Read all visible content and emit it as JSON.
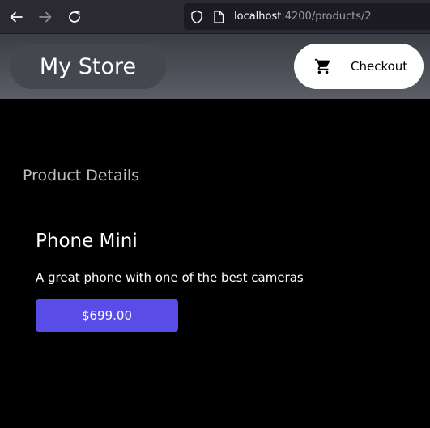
{
  "browser": {
    "url_host": "localhost",
    "url_path": ":4200/products/2"
  },
  "toolbar": {
    "store_title": "My Store",
    "checkout_label": "Checkout"
  },
  "page": {
    "section_title": "Product Details",
    "product": {
      "name": "Phone Mini",
      "description": "A great phone with one of the best cameras",
      "price": "$699.00"
    }
  },
  "colors": {
    "page_background": "#000000",
    "price_button": "#5a4ce6",
    "checkout_button": "#ffffff"
  },
  "icons": {
    "back": "arrow-left-icon",
    "forward": "arrow-right-icon",
    "reload": "reload-icon",
    "security": "shield-icon",
    "page": "page-icon",
    "cart": "shopping-cart-icon"
  }
}
